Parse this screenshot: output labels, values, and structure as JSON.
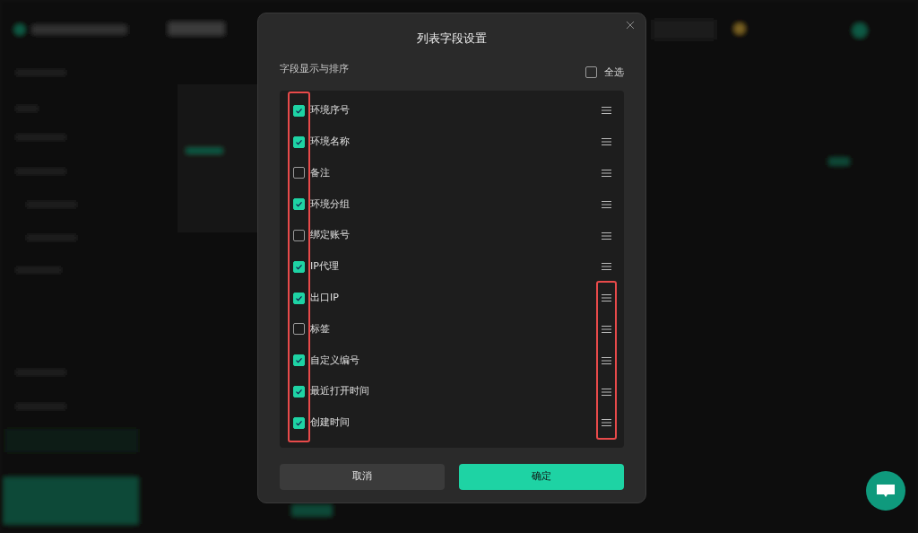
{
  "dialog": {
    "title": "列表字段设置",
    "subtitle": "字段显示与排序",
    "select_all": {
      "label": "全选",
      "checked": false
    },
    "fields": [
      {
        "label": "环境序号",
        "checked": true
      },
      {
        "label": "环境名称",
        "checked": true
      },
      {
        "label": "备注",
        "checked": false
      },
      {
        "label": "环境分组",
        "checked": true
      },
      {
        "label": "绑定账号",
        "checked": false
      },
      {
        "label": "IP代理",
        "checked": true
      },
      {
        "label": "出口IP",
        "checked": true
      },
      {
        "label": "标签",
        "checked": false
      },
      {
        "label": "自定义编号",
        "checked": true
      },
      {
        "label": "最近打开时间",
        "checked": true
      },
      {
        "label": "创建时间",
        "checked": true
      }
    ],
    "buttons": [
      {
        "label": "取消",
        "kind": "secondary"
      },
      {
        "label": "确定",
        "kind": "primary"
      }
    ]
  }
}
